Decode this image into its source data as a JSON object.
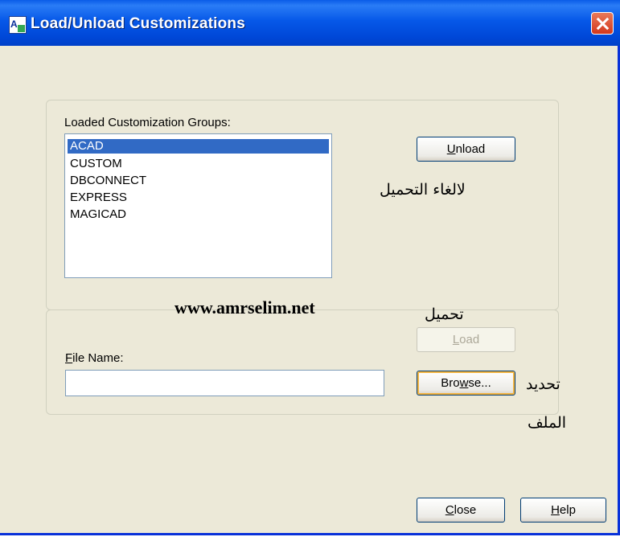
{
  "window": {
    "title": "Load/Unload Customizations"
  },
  "groups_section": {
    "label": "Loaded Customization Groups:",
    "items": [
      "ACAD",
      "CUSTOM",
      "DBCONNECT",
      "EXPRESS",
      "MAGICAD"
    ],
    "selected_index": 0,
    "unload_label_prefix": "",
    "unload_label_mnemonic": "U",
    "unload_label_rest": "nload"
  },
  "file_section": {
    "label_mnemonic": "F",
    "label_rest": "ile Name:",
    "file_value": "",
    "load_mnemonic": "L",
    "load_rest": "oad",
    "browse_prefix": "Bro",
    "browse_mnemonic": "w",
    "browse_rest": "se..."
  },
  "footer": {
    "close_mnemonic": "C",
    "close_rest": "lose",
    "help_mnemonic": "H",
    "help_rest": "elp"
  },
  "annotations": {
    "unload_ar": "لالغاء التحميل",
    "load_ar": "تحميل",
    "browse_ar_line1": "تحديد",
    "browse_ar_line2": "الملف",
    "watermark": "www.amrselim.net"
  }
}
